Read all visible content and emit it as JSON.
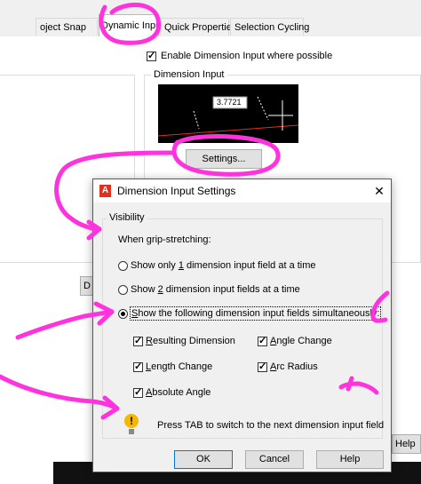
{
  "background": {
    "tabs": [
      {
        "label": "oject Snap"
      },
      {
        "label": "Dynamic Input"
      },
      {
        "label": "Quick Properties"
      },
      {
        "label": "Selection Cycling"
      }
    ],
    "enable_dimension_input": {
      "label": "Enable Dimension Input where possible",
      "checked": true
    },
    "dimension_input_group": "Dimension Input",
    "preview_value": "3.7721",
    "settings_button": "Settings...",
    "partial_button_left": "D",
    "partial_help_right": "Help"
  },
  "dialog": {
    "title": "Dimension Input Settings",
    "visibility_group": "Visibility",
    "when_label": "When grip-stretching:",
    "options": [
      {
        "pre": "Show only ",
        "key": "1",
        "post": " dimension input field at a time",
        "selected": false
      },
      {
        "pre": "Show ",
        "key": "2",
        "post": " dimension input fields at a time",
        "selected": false
      },
      {
        "pre": "",
        "key": "S",
        "post": "how the following dimension input fields simultaneously:",
        "selected": true
      }
    ],
    "fields": [
      {
        "key": "R",
        "post": "esulting Dimension",
        "checked": true
      },
      {
        "key": "A",
        "post": "ngle Change",
        "checked": true
      },
      {
        "key": "L",
        "post": "ength Change",
        "checked": true
      },
      {
        "key": "A",
        "post": "rc Radius",
        "checked": true
      },
      {
        "key": "A",
        "post": "bsolute Angle",
        "checked": true
      }
    ],
    "tip": "Press TAB to switch to the next dimension input field",
    "ok": "OK",
    "cancel": "Cancel",
    "help": "Help"
  },
  "colors": {
    "annotation": "#ff33dd",
    "accent": "#0078d7",
    "autocad_red": "#e0301e"
  }
}
